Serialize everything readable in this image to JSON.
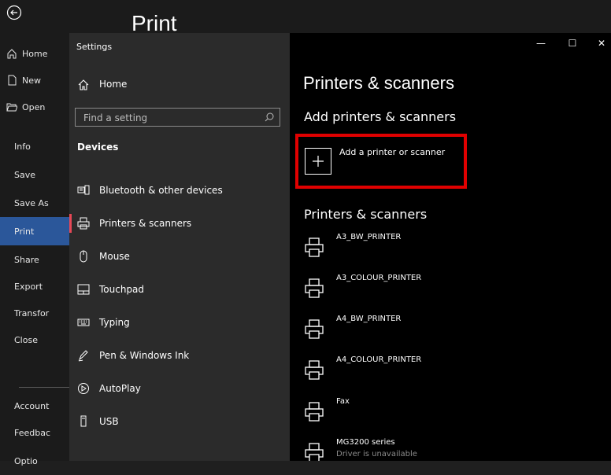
{
  "backstage": {
    "title": "Print",
    "items": [
      {
        "label": "Home",
        "icon": "home-icon"
      },
      {
        "label": "New",
        "icon": "new-document-icon"
      },
      {
        "label": "Open",
        "icon": "folder-open-icon"
      },
      {
        "label": "Info"
      },
      {
        "label": "Save"
      },
      {
        "label": "Save As"
      },
      {
        "label": "Print"
      },
      {
        "label": "Share"
      },
      {
        "label": "Export"
      },
      {
        "label": "Transfor"
      },
      {
        "label": "Close"
      },
      {
        "label": "Account"
      },
      {
        "label": "Feedbac"
      },
      {
        "label": "Optio"
      }
    ]
  },
  "settings": {
    "window_title": "Settings",
    "home_label": "Home",
    "search_placeholder": "Find a setting",
    "section_label": "Devices",
    "nav_items": [
      {
        "label": "Bluetooth & other devices",
        "icon": "bluetooth-devices-icon"
      },
      {
        "label": "Printers & scanners",
        "icon": "printer-icon",
        "selected": true
      },
      {
        "label": "Mouse",
        "icon": "mouse-icon"
      },
      {
        "label": "Touchpad",
        "icon": "touchpad-icon"
      },
      {
        "label": "Typing",
        "icon": "keyboard-icon"
      },
      {
        "label": "Pen & Windows Ink",
        "icon": "pen-icon"
      },
      {
        "label": "AutoPlay",
        "icon": "autoplay-icon"
      },
      {
        "label": "USB",
        "icon": "usb-icon"
      }
    ],
    "window_controls": {
      "minimize": "—",
      "maximize": "☐",
      "close": "✕"
    }
  },
  "content": {
    "title": "Printers & scanners",
    "add_heading": "Add printers & scanners",
    "add_button_label": "Add a printer or scanner",
    "list_heading": "Printers & scanners",
    "printers": [
      {
        "name": "A3_BW_PRINTER"
      },
      {
        "name": "A3_COLOUR_PRINTER"
      },
      {
        "name": "A4_BW_PRINTER"
      },
      {
        "name": "A4_COLOUR_PRINTER"
      },
      {
        "name": "Fax"
      },
      {
        "name": "MG3200 series",
        "status": "Driver is unavailable"
      }
    ]
  },
  "colors": {
    "highlight": "#e00000",
    "selected_bar": "#e74856",
    "active_backstage": "#2b579a"
  }
}
